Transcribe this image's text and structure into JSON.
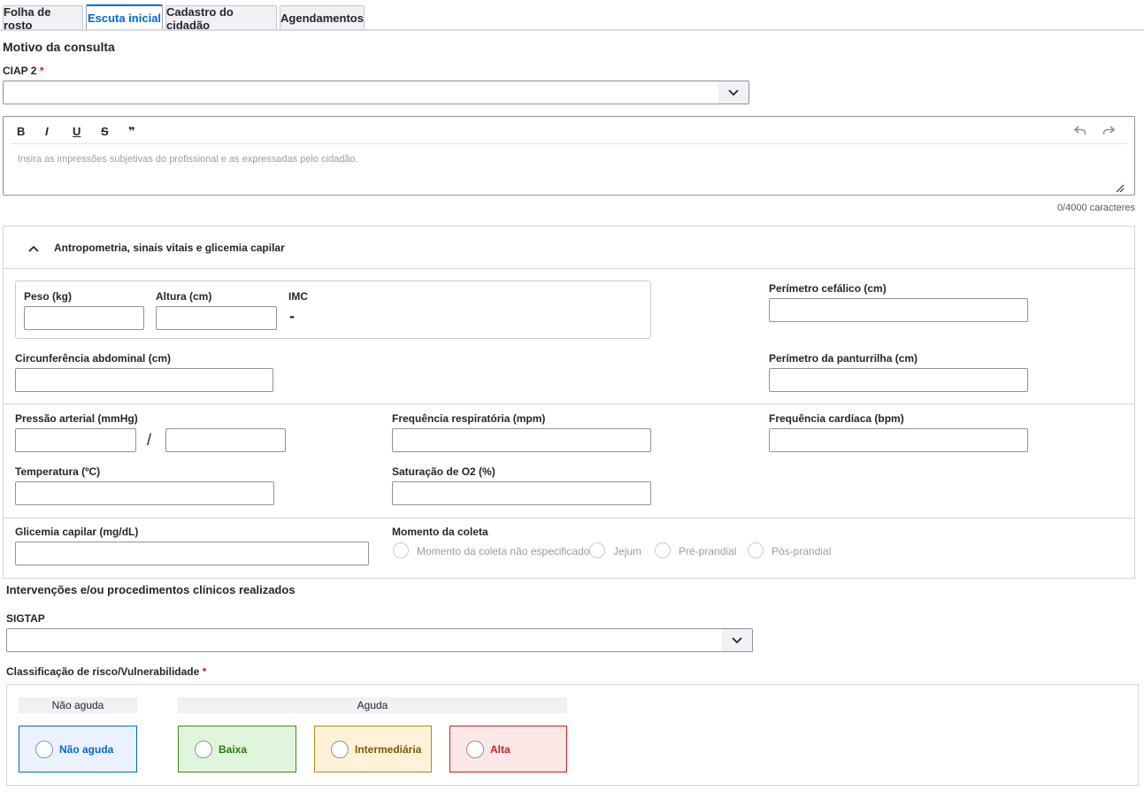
{
  "tabs": [
    {
      "label": "Folha de rosto",
      "active": false
    },
    {
      "label": "Escuta inicial",
      "active": true
    },
    {
      "label": "Cadastro do cidadão",
      "active": false
    },
    {
      "label": "Agendamentos",
      "active": false
    }
  ],
  "motivo": {
    "title": "Motivo da consulta",
    "ciap_label": "CIAP 2",
    "required_mark": "*",
    "ciap_value": ""
  },
  "editor": {
    "toolbar": {
      "bold": "B",
      "italic": "I",
      "underline": "U",
      "strike": "S",
      "quote": "❞"
    },
    "placeholder": "Insira as impressões subjetivas do profissional e as expressadas pelo cidadão.",
    "counter": "0/4000 caracteres"
  },
  "antro": {
    "title": "Antropometria, sinais vitais e glicemia capilar",
    "peso": "Peso (kg)",
    "altura": "Altura (cm)",
    "imc": "IMC",
    "imc_value": "-",
    "perimetro_cefalico": "Perímetro cefálico (cm)",
    "circunferencia": "Circunferência abdominal (cm)",
    "perimetro_panturrilha": "Perímetro da panturrilha (cm)",
    "pressao": "Pressão arterial (mmHg)",
    "pressao_sep": "/",
    "freq_resp": "Frequência respiratória (mpm)",
    "freq_card": "Frequência cardíaca (bpm)",
    "temperatura": "Temperatura (ºC)",
    "saturacao": "Saturação de O2 (%)",
    "glicemia": "Glicemia capilar (mg/dL)",
    "momento": "Momento da coleta",
    "momento_options": [
      "Momento da coleta não especificado",
      "Jejum",
      "Pré-prandial",
      "Pós-prandial"
    ]
  },
  "intervencoes": {
    "title": "Intervenções e/ou procedimentos clínicos realizados",
    "sigtap_label": "SIGTAP",
    "sigtap_value": ""
  },
  "risco": {
    "label": "Classificação de risco/Vulnerabilidade",
    "required_mark": "*",
    "group_nao_aguda": "Não aguda",
    "group_aguda": "Aguda",
    "options": [
      {
        "label": "Não aguda",
        "color": "#0069d0",
        "bg": "#ebf2ff",
        "border": "#0069d0"
      },
      {
        "label": "Baixa",
        "color": "#2b7a0b",
        "bg": "#e0f6dc",
        "border": "#3f8a1a"
      },
      {
        "label": "Intermediária",
        "color": "#7a5a00",
        "bg": "#fff2d8",
        "border": "#b08a17"
      },
      {
        "label": "Alta",
        "color": "#c5232b",
        "bg": "#fde8e8",
        "border": "#d01c1c"
      }
    ]
  }
}
